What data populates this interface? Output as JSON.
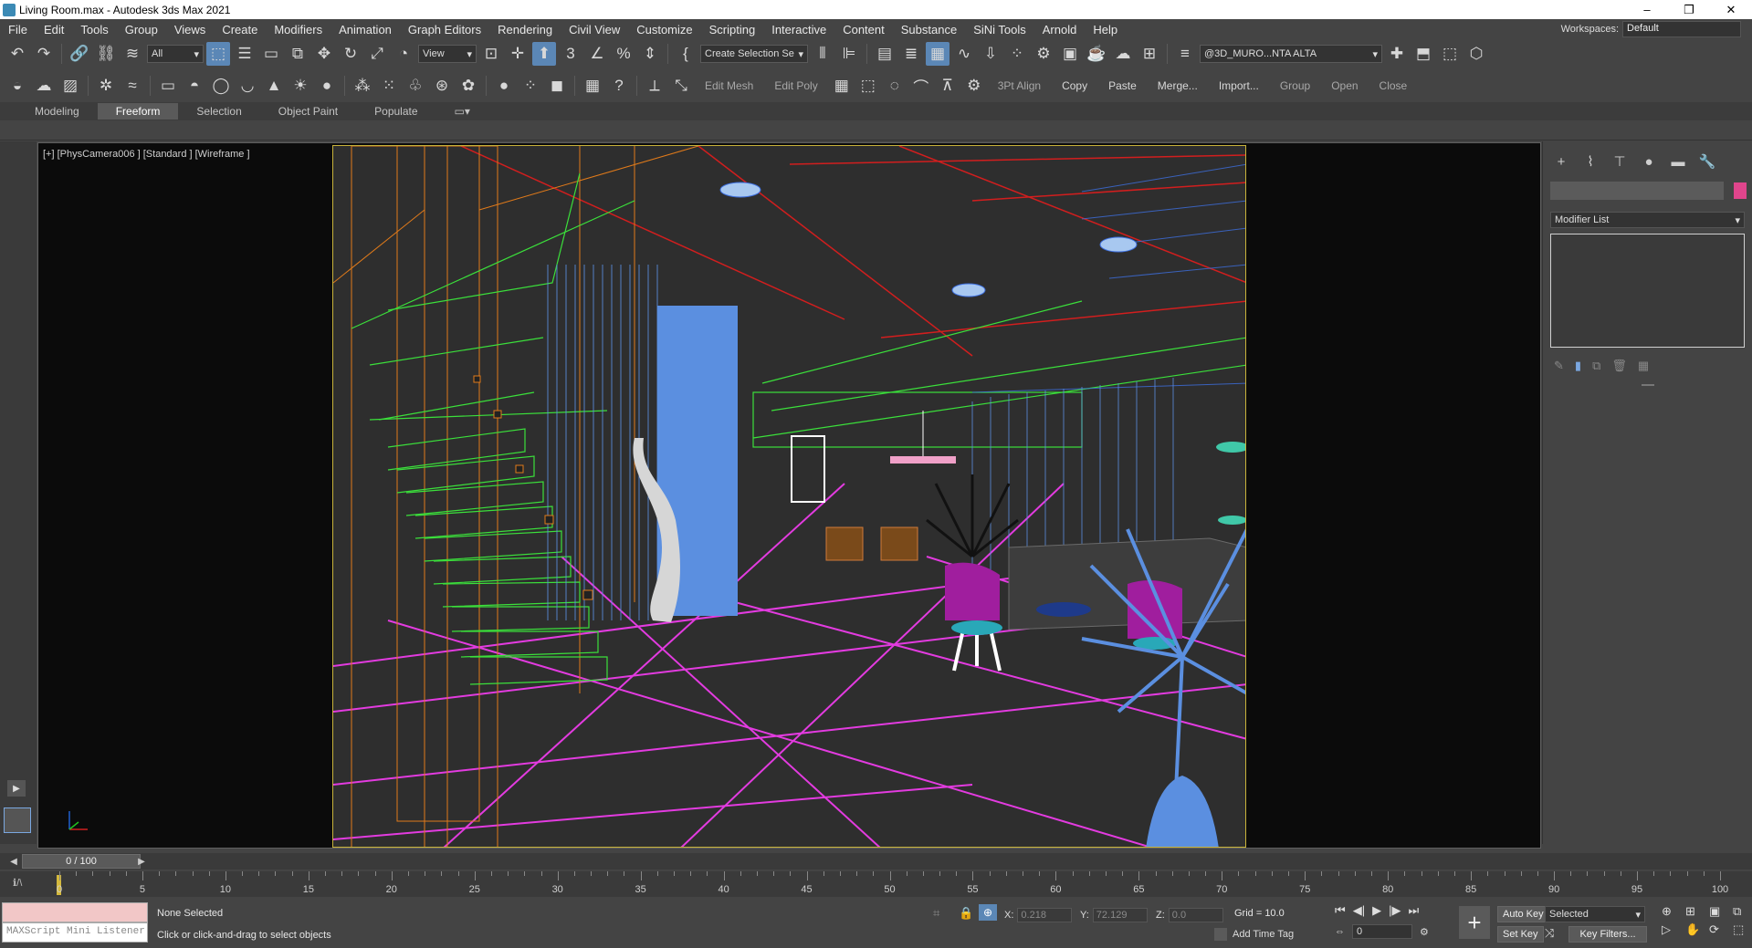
{
  "window": {
    "title": "Living Room.max - Autodesk 3ds Max 2021",
    "minimize": "–",
    "restore": "❐",
    "close": "✕"
  },
  "menu": [
    "File",
    "Edit",
    "Tools",
    "Group",
    "Views",
    "Create",
    "Modifiers",
    "Animation",
    "Graph Editors",
    "Rendering",
    "Civil View",
    "Customize",
    "Scripting",
    "Interactive",
    "Content",
    "Substance",
    "SiNi Tools",
    "Arnold",
    "Help"
  ],
  "workspace": {
    "label": "Workspaces:",
    "value": "Default"
  },
  "toolbar1": {
    "filter": "All",
    "ref_coord": "View",
    "selection_set": "Create Selection Se",
    "layer": "@3D_MURO...NTA ALTA"
  },
  "toolbar2": {
    "text_buttons": [
      "Edit Mesh",
      "Edit Poly",
      "3Pt Align",
      "Copy",
      "Paste",
      "Merge...",
      "Import...",
      "Group",
      "Open",
      "Close"
    ]
  },
  "ribbon_tabs": [
    "Modeling",
    "Freeform",
    "Selection",
    "Object Paint",
    "Populate"
  ],
  "ribbon_active": "Freeform",
  "viewport": {
    "label": "[+] [PhysCamera006 ] [Standard ] [Wireframe ]"
  },
  "command_panel": {
    "modifier_list": "Modifier List"
  },
  "timeline": {
    "slider": "0 / 100",
    "ticks": [
      "0",
      "5",
      "10",
      "15",
      "20",
      "25",
      "30",
      "35",
      "40",
      "45",
      "50",
      "55",
      "60",
      "65",
      "70",
      "75",
      "80",
      "85",
      "90",
      "95",
      "100"
    ]
  },
  "status": {
    "maxscript": "MAXScript Mini Listener",
    "selection": "None Selected",
    "prompt": "Click or click-and-drag to select objects",
    "x_label": "X:",
    "x": "0.218",
    "y_label": "Y:",
    "y": "72.129",
    "z_label": "Z:",
    "z": "0.0",
    "grid": "Grid = 10.0",
    "add_time_tag": "Add Time Tag",
    "frame": "0",
    "auto_key": "Auto Key",
    "set_key": "Set Key",
    "selected": "Selected",
    "key_filters": "Key Filters..."
  },
  "colors": {
    "accent": "#5b87b6",
    "safe_frame": "#c8b33a",
    "wire_magenta": "#e33be0",
    "wire_green": "#3be03b",
    "wire_orange": "#e07a1a",
    "wire_red": "#d21e1e",
    "object_blue": "#5b8fe0",
    "object_purple": "#a01e9e"
  }
}
